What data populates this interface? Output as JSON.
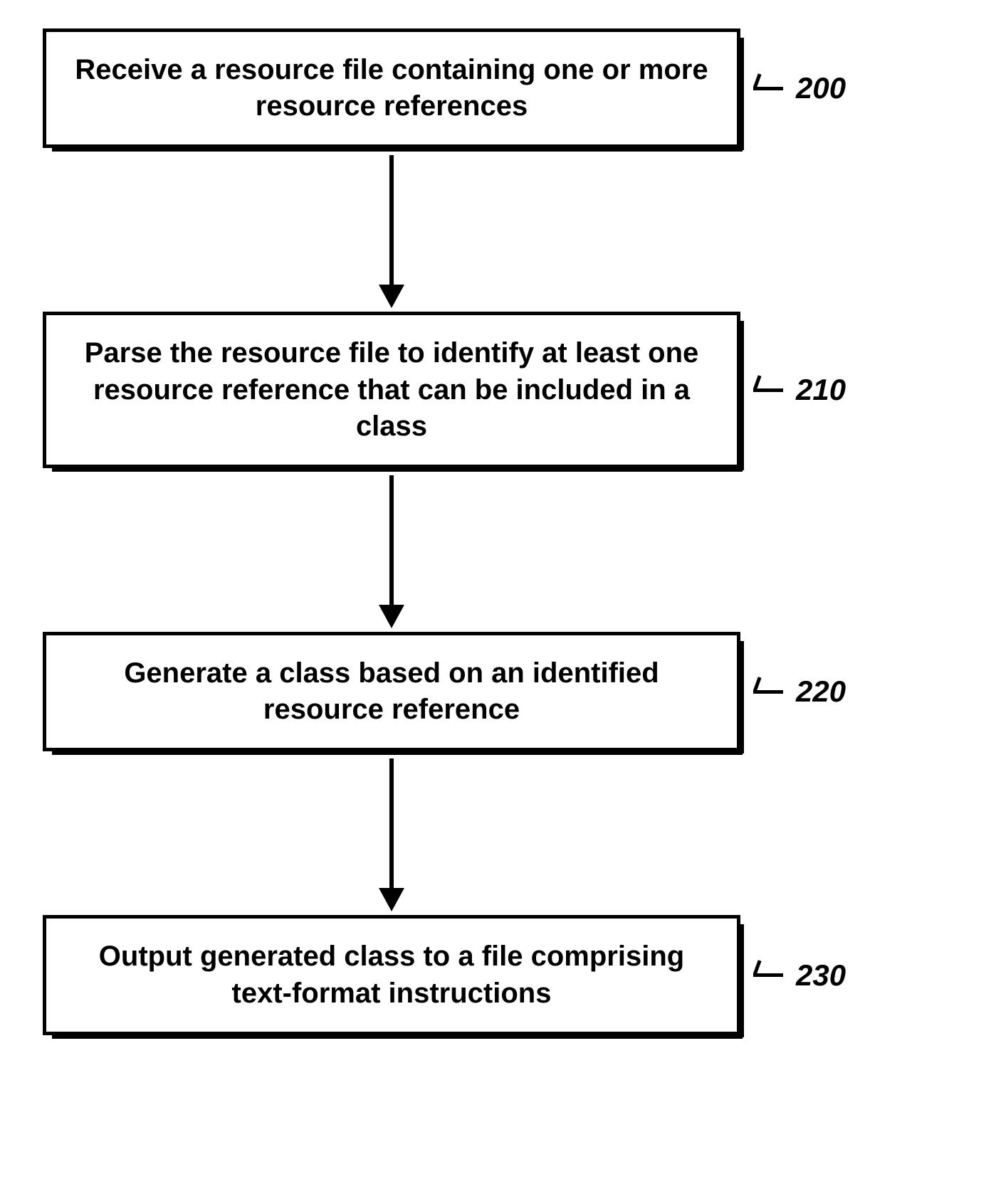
{
  "flowchart": {
    "steps": [
      {
        "ref": "200",
        "text": "Receive a resource file containing one or more resource references"
      },
      {
        "ref": "210",
        "text": "Parse the resource file to identify at least one resource reference that can be included in a class"
      },
      {
        "ref": "220",
        "text": "Generate a class based on an identified resource reference"
      },
      {
        "ref": "230",
        "text": "Output generated class to a file comprising text-format instructions"
      }
    ]
  }
}
